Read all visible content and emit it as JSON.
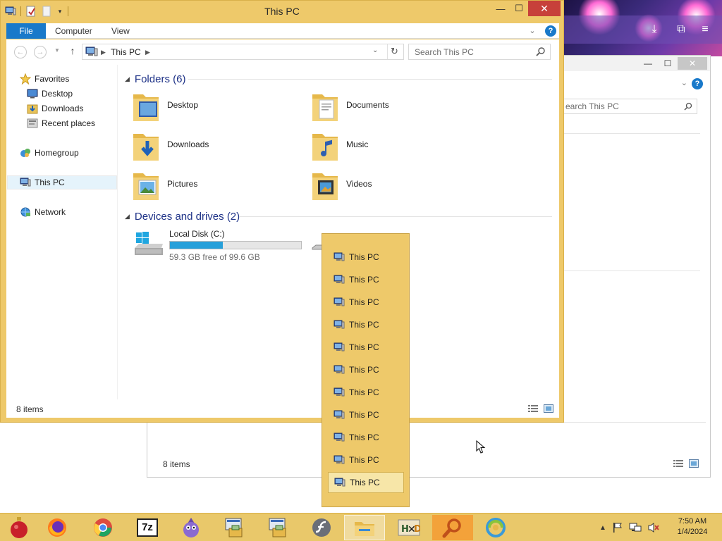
{
  "window": {
    "title": "This PC",
    "minimize_label": "—",
    "maximize_label": "☐",
    "close_label": "✕"
  },
  "ribbon": {
    "file_tab": "File",
    "tabs": [
      "Computer",
      "View"
    ],
    "help_label": "?"
  },
  "navigation": {
    "back_label": "←",
    "forward_label": "→",
    "up_label": "↑",
    "breadcrumb": "This PC",
    "search_placeholder": "Search This PC"
  },
  "nav_pane": {
    "favorites": "Favorites",
    "favorites_items": [
      "Desktop",
      "Downloads",
      "Recent places"
    ],
    "homegroup": "Homegroup",
    "this_pc": "This PC",
    "network": "Network"
  },
  "folders_group": {
    "title": "Folders (6)",
    "items": [
      "Desktop",
      "Documents",
      "Downloads",
      "Music",
      "Pictures",
      "Videos"
    ]
  },
  "devices_group": {
    "title": "Devices and drives (2)",
    "drive_name": "Local Disk (C:)",
    "drive_free": "59.3 GB free of 99.6 GB",
    "drive_used_fraction": 0.405
  },
  "status": {
    "item_count": "8 items"
  },
  "background_window": {
    "search_placeholder": "earch This PC",
    "item_count": "8 items"
  },
  "jump_list": {
    "items": [
      "This PC",
      "This PC",
      "This PC",
      "This PC",
      "This PC",
      "This PC",
      "This PC",
      "This PC",
      "This PC",
      "This PC",
      "This PC"
    ],
    "active_index": 10
  },
  "taskbar": {
    "apps": [
      "ornament-icon",
      "firefox-icon",
      "chrome-icon",
      "7zip-icon",
      "pidgin-icon",
      "installer-icon",
      "installer-icon",
      "flash-icon",
      "file-explorer-icon",
      "hxd-icon",
      "search-magnifier-icon",
      "browser-swirl-icon"
    ],
    "sevenzip_label": "7z"
  },
  "clock": {
    "time": "7:50 AM",
    "date": "1/4/2024"
  },
  "colors": {
    "window_frame": "#eec96a",
    "accent_blue": "#1979ca",
    "group_header": "#1e3287",
    "close_red": "#c7403a",
    "drive_fill": "#26a0da"
  }
}
